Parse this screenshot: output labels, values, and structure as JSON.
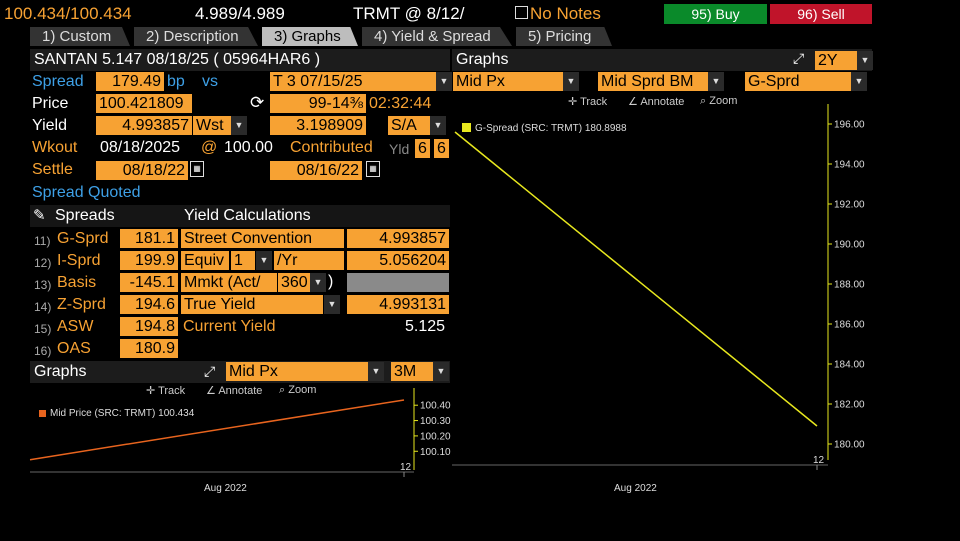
{
  "top": {
    "bid_ask": "100.434/100.434",
    "yield_pair": "4.989/4.989",
    "source": "TRMT @ 8/12/",
    "notes": "No Notes",
    "buy_label": "95) Buy",
    "sell_label": "96) Sell",
    "colors": {
      "buy": "#0a8a2a",
      "sell": "#c0142a",
      "accent": "#f7a233"
    }
  },
  "tabs": [
    {
      "label": "1) Custom"
    },
    {
      "label": "2) Description"
    },
    {
      "label": "3) Graphs",
      "active": true
    },
    {
      "label": "4) Yield & Spread"
    },
    {
      "label": "5) Pricing"
    }
  ],
  "bond": {
    "title": "SANTAN 5.147 08/18/25 ( 05964HAR6 )",
    "spread_label": "Spread",
    "spread_value": "179.49",
    "spread_unit": "bp",
    "vs_label": "vs",
    "benchmark": "T 3 07/15/25",
    "price_label": "Price",
    "price_value": "100.421809",
    "bench_price": "99-14⅜",
    "time": "02:32:44",
    "yield_label": "Yield",
    "yield_value": "4.993857",
    "yield_type": "Wst",
    "bench_yield": "3.198909",
    "freq": "S/A",
    "wkout_label": "Wkout",
    "wkout_date": "08/18/2025",
    "at_sign": "@",
    "wkout_price": "100.00",
    "contributed_label": "Contributed",
    "yld_label": "Yld",
    "yld_a": "6",
    "yld_b": "6",
    "settle_label": "Settle",
    "settle_date": "08/18/22",
    "bench_settle": "08/16/22",
    "spread_quoted": "Spread Quoted"
  },
  "spreads": {
    "header": "Spreads",
    "rows": [
      {
        "num": "11)",
        "label": "G-Sprd",
        "value": "181.1"
      },
      {
        "num": "12)",
        "label": "I-Sprd",
        "value": "199.9"
      },
      {
        "num": "13)",
        "label": "Basis",
        "value": "-145.1"
      },
      {
        "num": "14)",
        "label": "Z-Sprd",
        "value": "194.6"
      },
      {
        "num": "15)",
        "label": "ASW",
        "value": "194.8"
      },
      {
        "num": "16)",
        "label": "OAS",
        "value": "180.9"
      }
    ]
  },
  "yield_calc": {
    "header": "Yield Calculations",
    "street_label": "Street Convention",
    "street_value": "4.993857",
    "equiv_label": "Equiv",
    "equiv_num": "1",
    "equiv_suffix": "/Yr",
    "equiv_value": "5.056204",
    "mmkt_label": "Mmkt (Act/",
    "mmkt_num": "360",
    "mmkt_suffix": ")",
    "true_label": "True Yield",
    "true_value": "4.993131",
    "current_label": "Current Yield",
    "current_value": "5.125"
  },
  "small_graph": {
    "title": "Graphs",
    "measure": "Mid Px",
    "range": "3M",
    "track": "Track",
    "annotate": "Annotate",
    "zoom": "Zoom"
  },
  "big_graph": {
    "title": "Graphs",
    "range": "2Y",
    "sel1": "Mid Px",
    "sel2": "Mid Sprd BM",
    "sel3": "G-Sprd",
    "track": "Track",
    "annotate": "Annotate",
    "zoom": "Zoom"
  },
  "chart_data": [
    {
      "type": "line",
      "legend": "Mid Price (SRC: TRMT) 100.434",
      "x_tick_labels": [
        "Aug 2022",
        "12"
      ],
      "y_ticks": [
        100.1,
        100.2,
        100.3,
        100.4
      ],
      "ylim": [
        100.03,
        100.46
      ],
      "x": [
        0,
        1
      ],
      "values": [
        100.045,
        100.434
      ],
      "color": "#e8641e"
    },
    {
      "type": "line",
      "legend": "G-Spread (SRC: TRMT) 180.8988",
      "x_tick_labels": [
        "Aug 2022",
        "12"
      ],
      "y_ticks": [
        180.0,
        182.0,
        184.0,
        186.0,
        188.0,
        190.0,
        192.0,
        194.0,
        196.0
      ],
      "ylim": [
        179.6,
        196.6
      ],
      "x": [
        0,
        1
      ],
      "values": [
        195.6,
        180.9
      ],
      "color": "#e8e81e"
    }
  ]
}
